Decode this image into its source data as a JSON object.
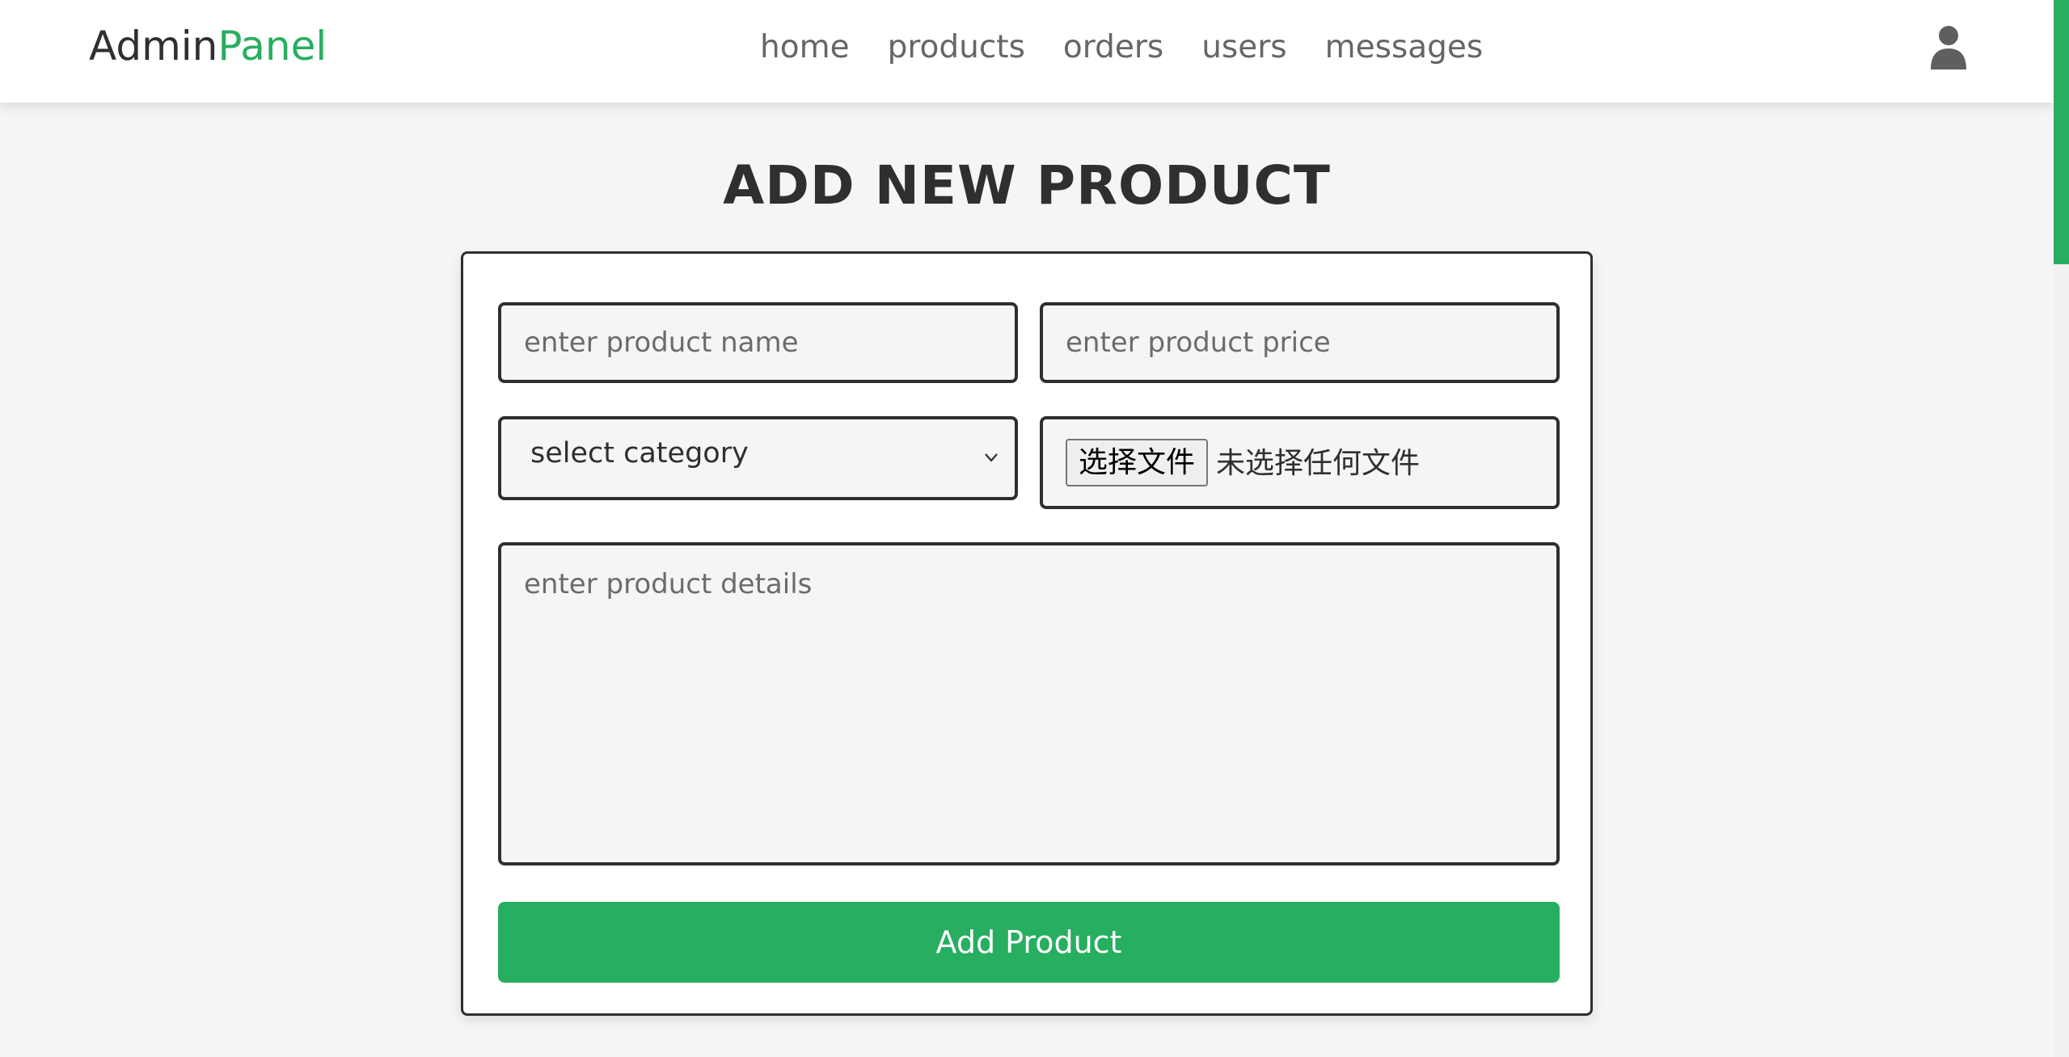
{
  "header": {
    "logo": {
      "part1": "Admin",
      "part2": "Panel"
    },
    "nav": [
      "home",
      "products",
      "orders",
      "users",
      "messages"
    ],
    "user_icon": "user-icon"
  },
  "main": {
    "title": "ADD NEW PRODUCT",
    "form": {
      "name_placeholder": "enter product name",
      "price_placeholder": "enter product price",
      "category_selected": "select category",
      "file_button_label": "选择文件",
      "file_status": "未选择任何文件",
      "details_placeholder": "enter product details",
      "submit_label": "Add Product"
    }
  },
  "colors": {
    "accent": "#27ae60",
    "text": "#2f2f2f",
    "background": "#f5f5f5"
  }
}
